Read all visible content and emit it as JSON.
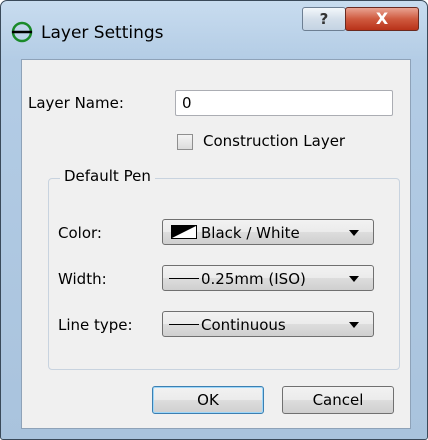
{
  "window": {
    "title": "Layer Settings",
    "help_label": "?",
    "close_label": "X"
  },
  "form": {
    "layer_name_label": "Layer Name:",
    "layer_name_value": "0",
    "construction_label": "Construction Layer",
    "construction_checked": false
  },
  "pen": {
    "group_title": "Default Pen",
    "color_label": "Color:",
    "color_value": "Black / White",
    "width_label": "Width:",
    "width_value": "0.25mm (ISO)",
    "linetype_label": "Line type:",
    "linetype_value": "Continuous"
  },
  "buttons": {
    "ok": "OK",
    "cancel": "Cancel"
  },
  "icons": {
    "app": "layer-icon",
    "color": "black-white-swatch-icon",
    "line": "line-icon",
    "dropdown": "chevron-down-icon"
  }
}
